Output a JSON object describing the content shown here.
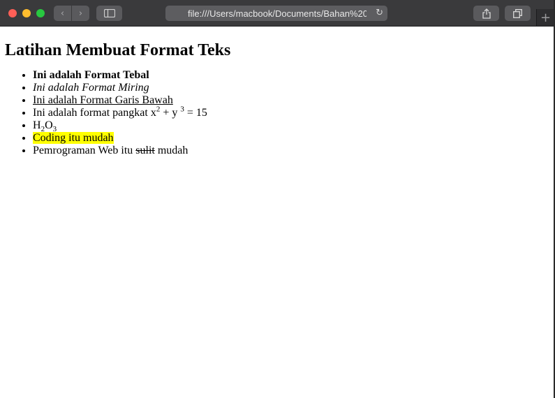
{
  "browser": {
    "url": "file:///Users/macbook/Documents/Bahan%20"
  },
  "page": {
    "heading": "Latihan Membuat Format Teks",
    "items": {
      "bold": "Ini adalah Format Tebal",
      "italic": "Ini adalah Format Miring",
      "underline": "Ini adalah Format Garis Bawah",
      "power": {
        "prefix": "Ini adalah format pangkat x",
        "exp1": "2",
        "mid": " + y ",
        "exp2": "3",
        "suffix": " = 15"
      },
      "formula": {
        "h": "H",
        "sub1": "2",
        "o": "O",
        "sub2": "3"
      },
      "highlight": "Coding itu mudah",
      "strike": {
        "prefix": "Pemrograman Web itu ",
        "struck": "sulit",
        "suffix": " mudah"
      }
    }
  },
  "colors": {
    "highlight": "#ffff00",
    "titlebar": "#3a3a3c"
  }
}
